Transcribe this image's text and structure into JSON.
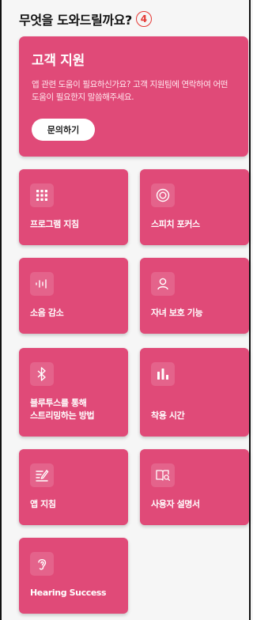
{
  "header": {
    "title": "무엇을 도와드릴까요?",
    "annotation_badge": "4"
  },
  "support_card": {
    "title": "고객 지원",
    "description": "앱 관련 도움이 필요하신가요? 고객 지원팀에 연락하여 어떤 도움이 필요한지 말씀해주세요.",
    "button_label": "문의하기"
  },
  "tiles": [
    {
      "label": "프로그램 지침",
      "icon": "grid-icon"
    },
    {
      "label": "스피치 포커스",
      "icon": "target-icon"
    },
    {
      "label": "소음 감소",
      "icon": "sound-wave-icon"
    },
    {
      "label": "자녀 보호 기능",
      "icon": "person-icon"
    },
    {
      "label": "블루투스를 통해\n스트리밍하는 방법",
      "icon": "bluetooth-icon"
    },
    {
      "label": "착용 시간",
      "icon": "bar-chart-icon"
    },
    {
      "label": "앱 지침",
      "icon": "edit-list-icon"
    },
    {
      "label": "사용자 설명서",
      "icon": "book-search-icon"
    },
    {
      "label": "Hearing Success",
      "icon": "ear-icon"
    }
  ],
  "colors": {
    "tile": "#e04a78",
    "background": "#f6f6f6",
    "annotation": "#e53935"
  }
}
